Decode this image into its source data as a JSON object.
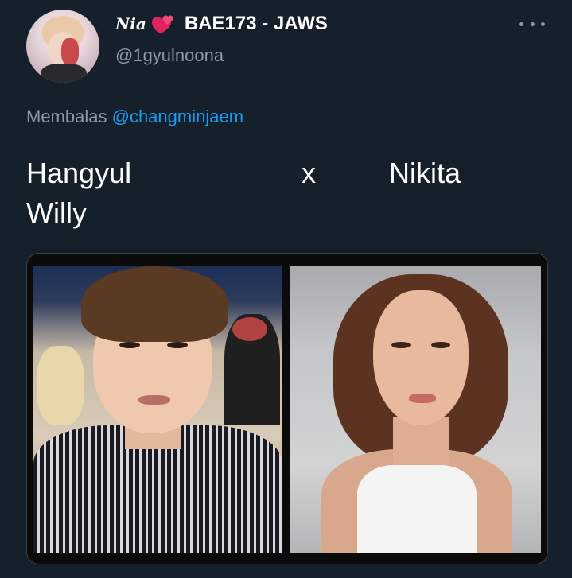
{
  "author": {
    "script_name": "Nia",
    "display_name": "BAE173 - JAWS",
    "handle": "@1gyulnoona",
    "avatar_icon": "profile-photo",
    "heart_icon": "heart-emoji-icon"
  },
  "header": {
    "more_icon": "more-options-icon"
  },
  "reply": {
    "prefix": "Membalas",
    "mention": "@changminjaem"
  },
  "tweet": {
    "word1": "Hangyul",
    "word2": "x",
    "word3": "Nikita",
    "word4": "Willy"
  },
  "media": {
    "left_image": "photo-man",
    "right_image": "photo-woman"
  },
  "colors": {
    "background": "#15202b",
    "secondary_text": "#8b98a5",
    "link": "#1d9bf0",
    "heart": "#e0245e"
  }
}
